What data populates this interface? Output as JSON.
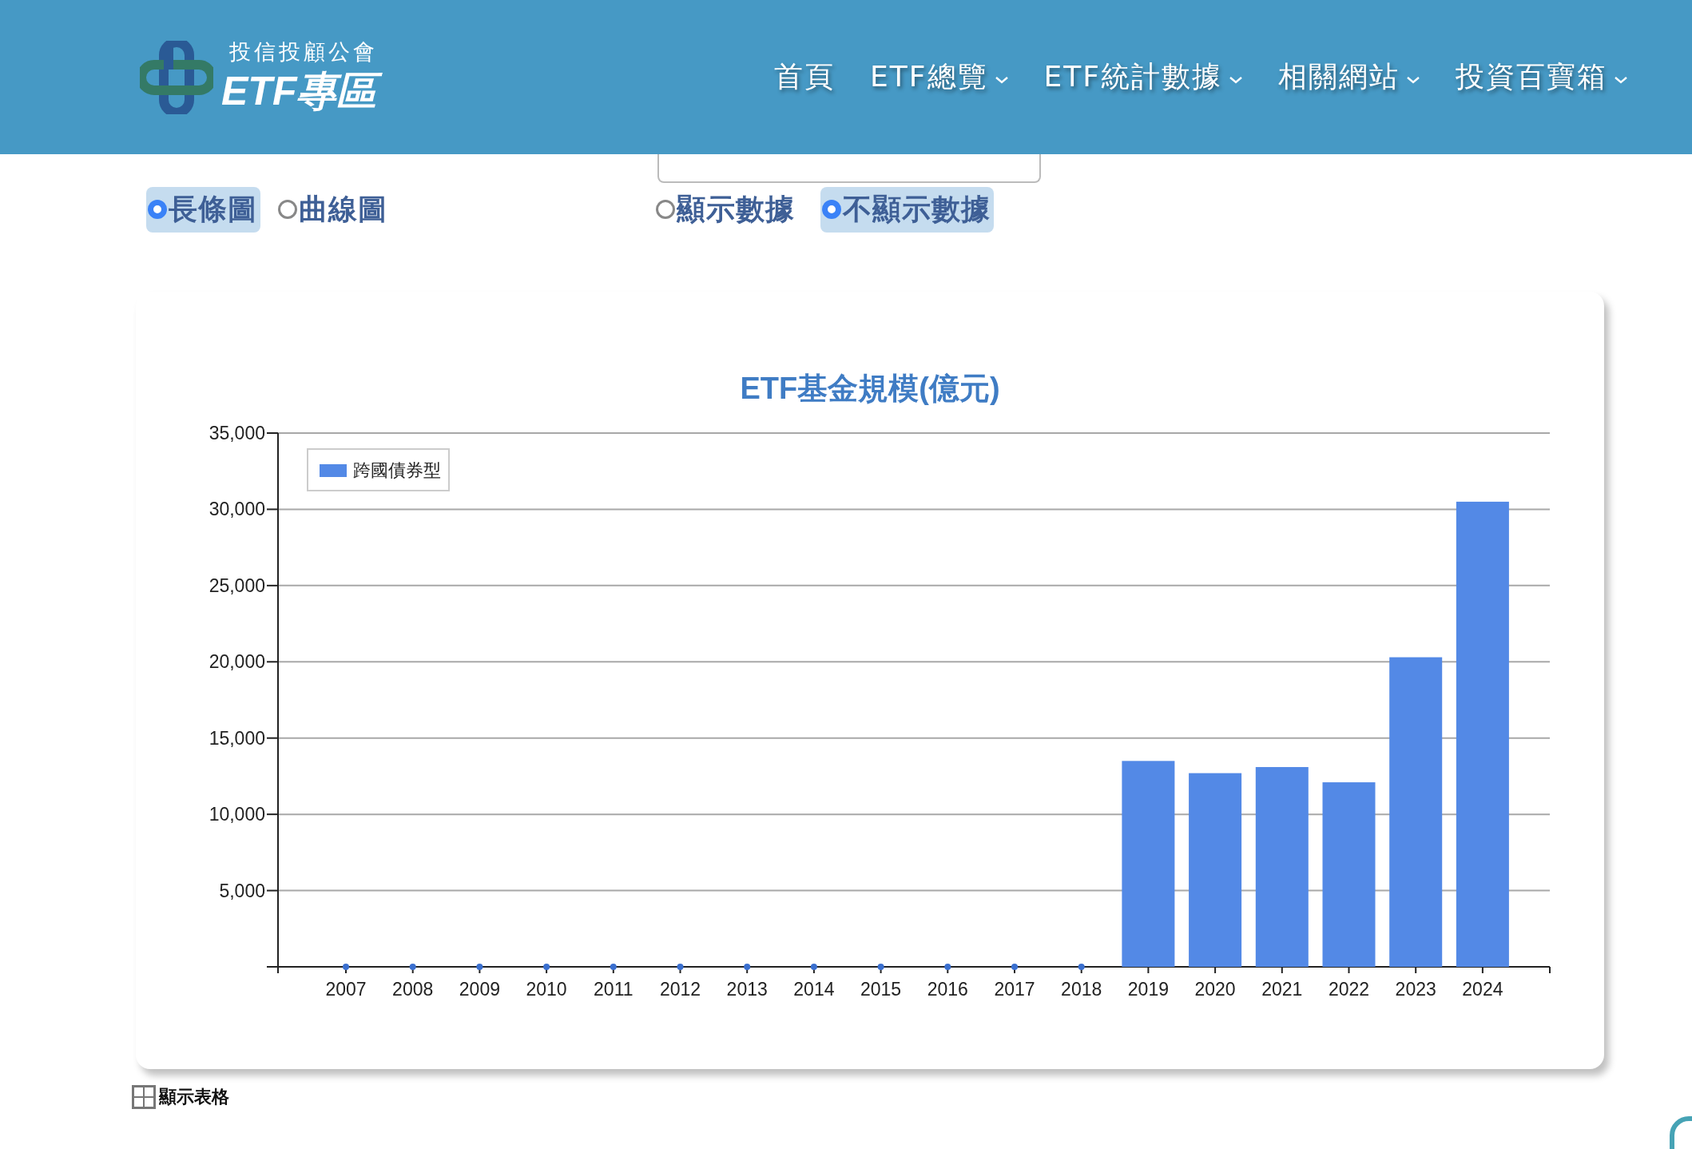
{
  "header": {
    "logo": {
      "org": "投信投顧公會",
      "title": "ETF專區"
    },
    "nav": [
      {
        "label": "首頁",
        "dropdown": false
      },
      {
        "label": "ETF總覽",
        "dropdown": true
      },
      {
        "label": "ETF統計數據",
        "dropdown": true
      },
      {
        "label": "相關網站",
        "dropdown": true
      },
      {
        "label": "投資百寶箱",
        "dropdown": true
      }
    ]
  },
  "chart_type_options": [
    {
      "label": "長條圖",
      "selected": true
    },
    {
      "label": "曲線圖",
      "selected": false
    }
  ],
  "data_label_options": [
    {
      "label": "顯示數據",
      "selected": false
    },
    {
      "label": "不顯示數據",
      "selected": true
    }
  ],
  "chart": {
    "chart_data": {
      "type": "bar",
      "title": "ETF基金規模(億元)",
      "grid": true,
      "categories": [
        "2007",
        "2008",
        "2009",
        "2010",
        "2011",
        "2012",
        "2013",
        "2014",
        "2015",
        "2016",
        "2017",
        "2018",
        "2019",
        "2020",
        "2021",
        "2022",
        "2023",
        "2024"
      ],
      "series": [
        {
          "name": "跨國債券型",
          "color": "#5389e6",
          "values": [
            0,
            0,
            0,
            0,
            0,
            0,
            0,
            0,
            0,
            0,
            0,
            0,
            13500,
            12700,
            13100,
            12100,
            20300,
            30500
          ]
        }
      ],
      "ylim": [
        0,
        35000
      ],
      "yticks": [
        {
          "value": 5000,
          "label": "5,000"
        },
        {
          "value": 10000,
          "label": "10,000"
        },
        {
          "value": 15000,
          "label": "15,000"
        },
        {
          "value": 20000,
          "label": "20,000"
        },
        {
          "value": 25000,
          "label": "25,000"
        },
        {
          "value": 30000,
          "label": "30,000"
        },
        {
          "value": 35000,
          "label": "35,000"
        }
      ]
    }
  },
  "table_toggle": {
    "label": "顯示表格"
  }
}
